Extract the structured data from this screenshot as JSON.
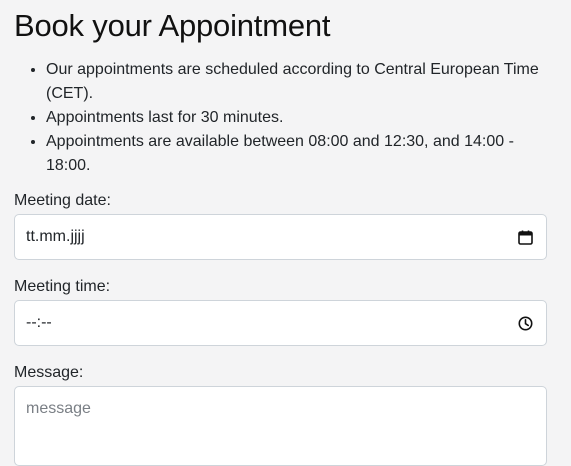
{
  "title": "Book your Appointment",
  "notes": [
    "Our appointments are scheduled according to Central European Time (CET).",
    "Appointments last for 30 minutes.",
    "Appointments are available between 08:00 and 12:30, and 14:00 - 18:00."
  ],
  "form": {
    "date": {
      "label": "Meeting date:",
      "value": "tt.mm.jjjj",
      "icon": "calendar-icon"
    },
    "time": {
      "label": "Meeting time:",
      "value": "--:--",
      "icon": "clock-icon"
    },
    "message": {
      "label": "Message:",
      "placeholder": "message"
    }
  }
}
